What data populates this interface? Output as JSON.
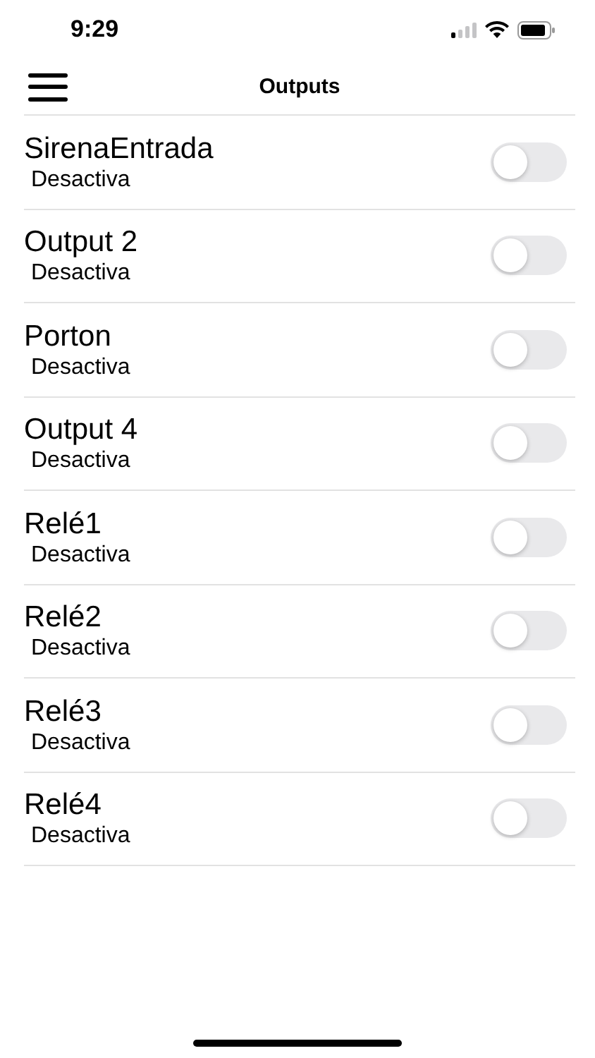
{
  "status_bar": {
    "time": "9:29"
  },
  "nav": {
    "title": "Outputs"
  },
  "outputs": [
    {
      "name": "SirenaEntrada",
      "status": "Desactiva",
      "on": false
    },
    {
      "name": "Output 2",
      "status": "Desactiva",
      "on": false
    },
    {
      "name": "Porton",
      "status": "Desactiva",
      "on": false
    },
    {
      "name": "Output 4",
      "status": "Desactiva",
      "on": false
    },
    {
      "name": "Relé1",
      "status": "Desactiva",
      "on": false
    },
    {
      "name": "Relé2",
      "status": "Desactiva",
      "on": false
    },
    {
      "name": "Relé3",
      "status": "Desactiva",
      "on": false
    },
    {
      "name": "Relé4",
      "status": "Desactiva",
      "on": false
    }
  ]
}
